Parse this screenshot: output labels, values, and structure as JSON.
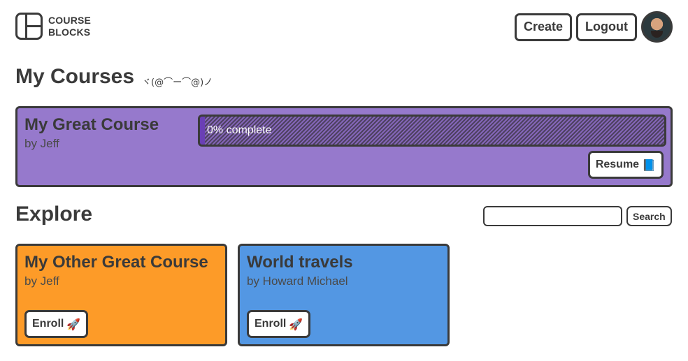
{
  "brand": {
    "line1": "COURSE",
    "line2": "BLOCKS"
  },
  "header": {
    "create_label": "Create",
    "logout_label": "Logout"
  },
  "my_courses": {
    "heading": "My Courses",
    "kaomoji": "ヾ(@⌒ー⌒@)ノ",
    "course": {
      "title": "My Great Course",
      "author": "by Jeff",
      "progress": 0,
      "progress_text": "0% complete",
      "resume_label": "Resume",
      "resume_emoji": "📘",
      "color": "#9679cc"
    }
  },
  "explore": {
    "heading": "Explore",
    "search": {
      "value": "",
      "placeholder": "",
      "button_label": "Search"
    },
    "courses": [
      {
        "title": "My Other Great Course",
        "author": "by Jeff",
        "enroll_label": "Enroll",
        "emoji": "🚀",
        "color": "#fd9b28"
      },
      {
        "title": "World travels",
        "author": "by Howard Michael",
        "enroll_label": "Enroll",
        "emoji": "🚀",
        "color": "#5397e3"
      }
    ]
  },
  "icons": {
    "logo": "course-blocks-logo-icon",
    "avatar": "user-avatar"
  }
}
